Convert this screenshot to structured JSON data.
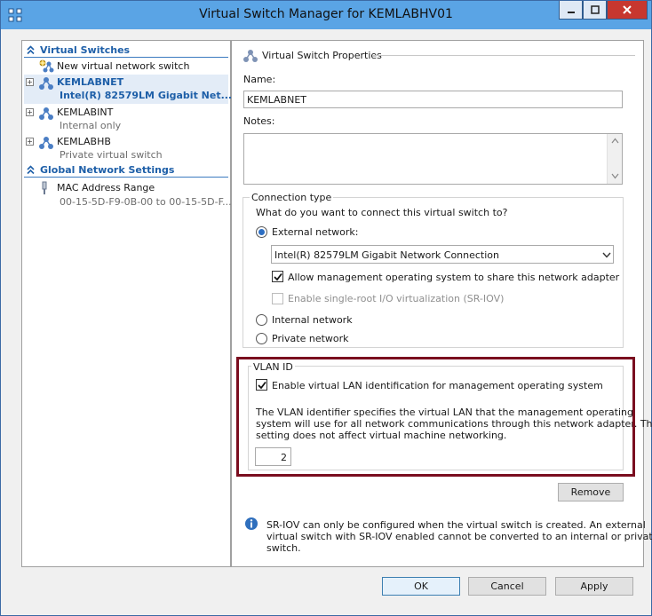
{
  "window": {
    "title": "Virtual Switch Manager for KEMLABHV01",
    "colors": {
      "titlebar": "#5aa4e5",
      "close": "#c7372f",
      "highlight": "#7a0d1f",
      "link": "#1e5fa8"
    }
  },
  "tree": {
    "virtual_switches_header": "Virtual Switches",
    "new_switch": "New virtual network switch",
    "switches": [
      {
        "name": "KEMLABNET",
        "detail": "Intel(R) 82579LM Gigabit Net...",
        "selected": true
      },
      {
        "name": "KEMLABINT",
        "detail": "Internal only",
        "selected": false
      },
      {
        "name": "KEMLABHB",
        "detail": "Private virtual switch",
        "selected": false
      }
    ],
    "global_header": "Global Network Settings",
    "mac_range": {
      "name": "MAC Address Range",
      "detail": "00-15-5D-F9-0B-00 to 00-15-5D-F..."
    }
  },
  "props": {
    "section_title": "Virtual Switch Properties",
    "name_label": "Name:",
    "name_value": "KEMLABNET",
    "notes_label": "Notes:",
    "notes_value": "",
    "connection_type": {
      "label": "Connection type",
      "question": "What do you want to connect this virtual switch to?",
      "external_label": "External network:",
      "external_selected": true,
      "adapter": "Intel(R) 82579LM Gigabit Network Connection",
      "allow_mgmt_label": "Allow management operating system to share this network adapter",
      "allow_mgmt_checked": true,
      "sriov_label": "Enable single-root I/O virtualization (SR-IOV)",
      "sriov_checked": false,
      "internal_label": "Internal network",
      "private_label": "Private network"
    },
    "vlan": {
      "label": "VLAN ID",
      "enable_label": "Enable virtual LAN identification for management operating system",
      "enable_checked": true,
      "description_lines": [
        "The VLAN identifier specifies the virtual LAN that the management operating",
        "system will use for all network communications through this network adapter. This",
        "setting does not affect virtual machine networking."
      ],
      "id_value": "2"
    },
    "remove_label": "Remove",
    "info_lines": [
      "SR-IOV can only be configured when the virtual switch is created. An external",
      "virtual switch with SR-IOV enabled cannot be converted to an internal or private",
      "switch."
    ]
  },
  "footer": {
    "ok": "OK",
    "cancel": "Cancel",
    "apply": "Apply"
  }
}
